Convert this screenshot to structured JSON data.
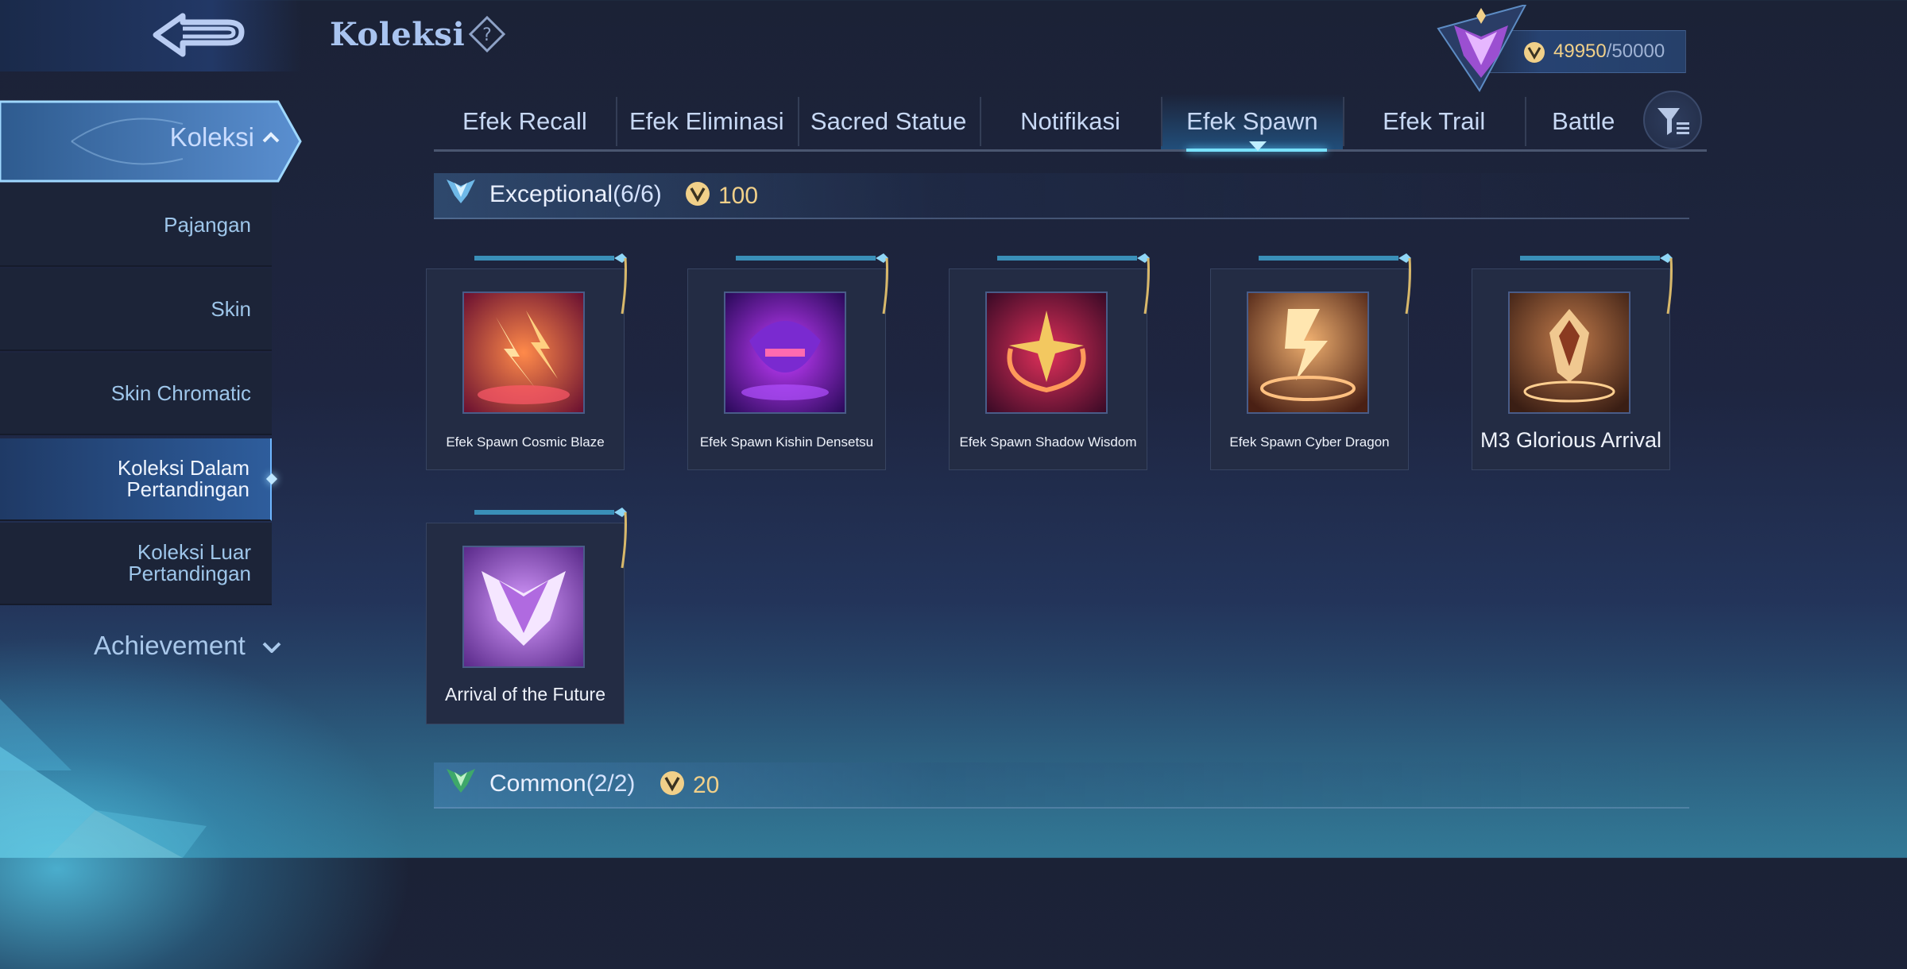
{
  "header": {
    "title": "Koleksi"
  },
  "points": {
    "current": "49950",
    "separator": "/",
    "max": "50000"
  },
  "sidebar": {
    "active_label": "Koleksi",
    "items": [
      {
        "label": "Pajangan"
      },
      {
        "label": "Skin"
      },
      {
        "label": "Skin Chromatic"
      },
      {
        "label": "Koleksi Dalam Pertandingan"
      },
      {
        "label": "Koleksi Luar Pertandingan"
      }
    ],
    "achievement": "Achievement"
  },
  "tabs": [
    {
      "label": "Efek Recall"
    },
    {
      "label": "Efek Eliminasi"
    },
    {
      "label": "Sacred Statue"
    },
    {
      "label": "Notifikasi"
    },
    {
      "label": "Efek Spawn"
    },
    {
      "label": "Efek Trail"
    },
    {
      "label": "Battle"
    }
  ],
  "active_tab": "Efek Spawn",
  "sections": {
    "exceptional": {
      "title": "Exceptional",
      "count": "(6/6)",
      "points": "100"
    },
    "common": {
      "title": "Common",
      "count": "(2/2)",
      "points": "20"
    }
  },
  "items": [
    {
      "name": "Efek Spawn Cosmic Blaze"
    },
    {
      "name": "Efek Spawn Kishin Densetsu"
    },
    {
      "name": "Efek Spawn Shadow Wisdom"
    },
    {
      "name": "Efek Spawn Cyber Dragon"
    },
    {
      "name": "M3 Glorious Arrival"
    },
    {
      "name": "Arrival of the Future"
    }
  ],
  "colors": {
    "accent": "#79e2ff",
    "gold": "#f1d089",
    "panel": "#232c44",
    "selected": "#2e5d9c"
  }
}
